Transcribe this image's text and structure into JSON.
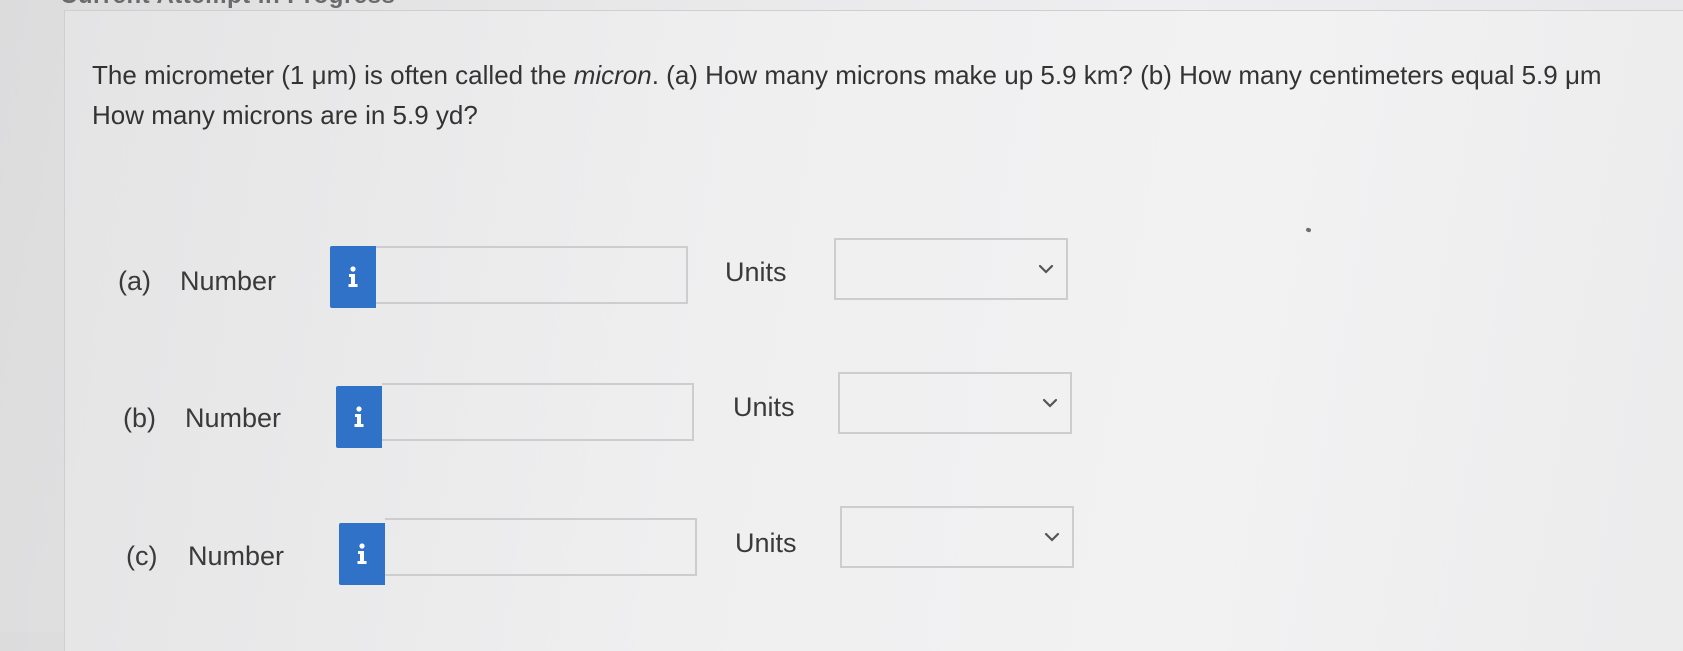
{
  "header": {
    "cutoff_title": "Current Attempt in Progress"
  },
  "question": {
    "line1_pre": "The micrometer (1 μm) is often called the ",
    "line1_italic": "micron",
    "line1_post": ". (a) How many microns make up 5.9 km? (b) How many centimeters equal 5.9 μm",
    "line2": "How many microns are in 5.9 yd?"
  },
  "parts": [
    {
      "letter": "(a)",
      "number_label": "Number",
      "number_value": "",
      "units_label": "Units",
      "units_value": ""
    },
    {
      "letter": "(b)",
      "number_label": "Number",
      "number_value": "",
      "units_label": "Units",
      "units_value": ""
    },
    {
      "letter": "(c)",
      "number_label": "Number",
      "number_value": "",
      "units_label": "Units",
      "units_value": ""
    }
  ],
  "icons": {
    "info": "info-icon",
    "dropdown": "chevron-down-icon"
  },
  "colors": {
    "info_button": "#2f72c8",
    "text": "#333333",
    "border": "#cdcdd0"
  }
}
